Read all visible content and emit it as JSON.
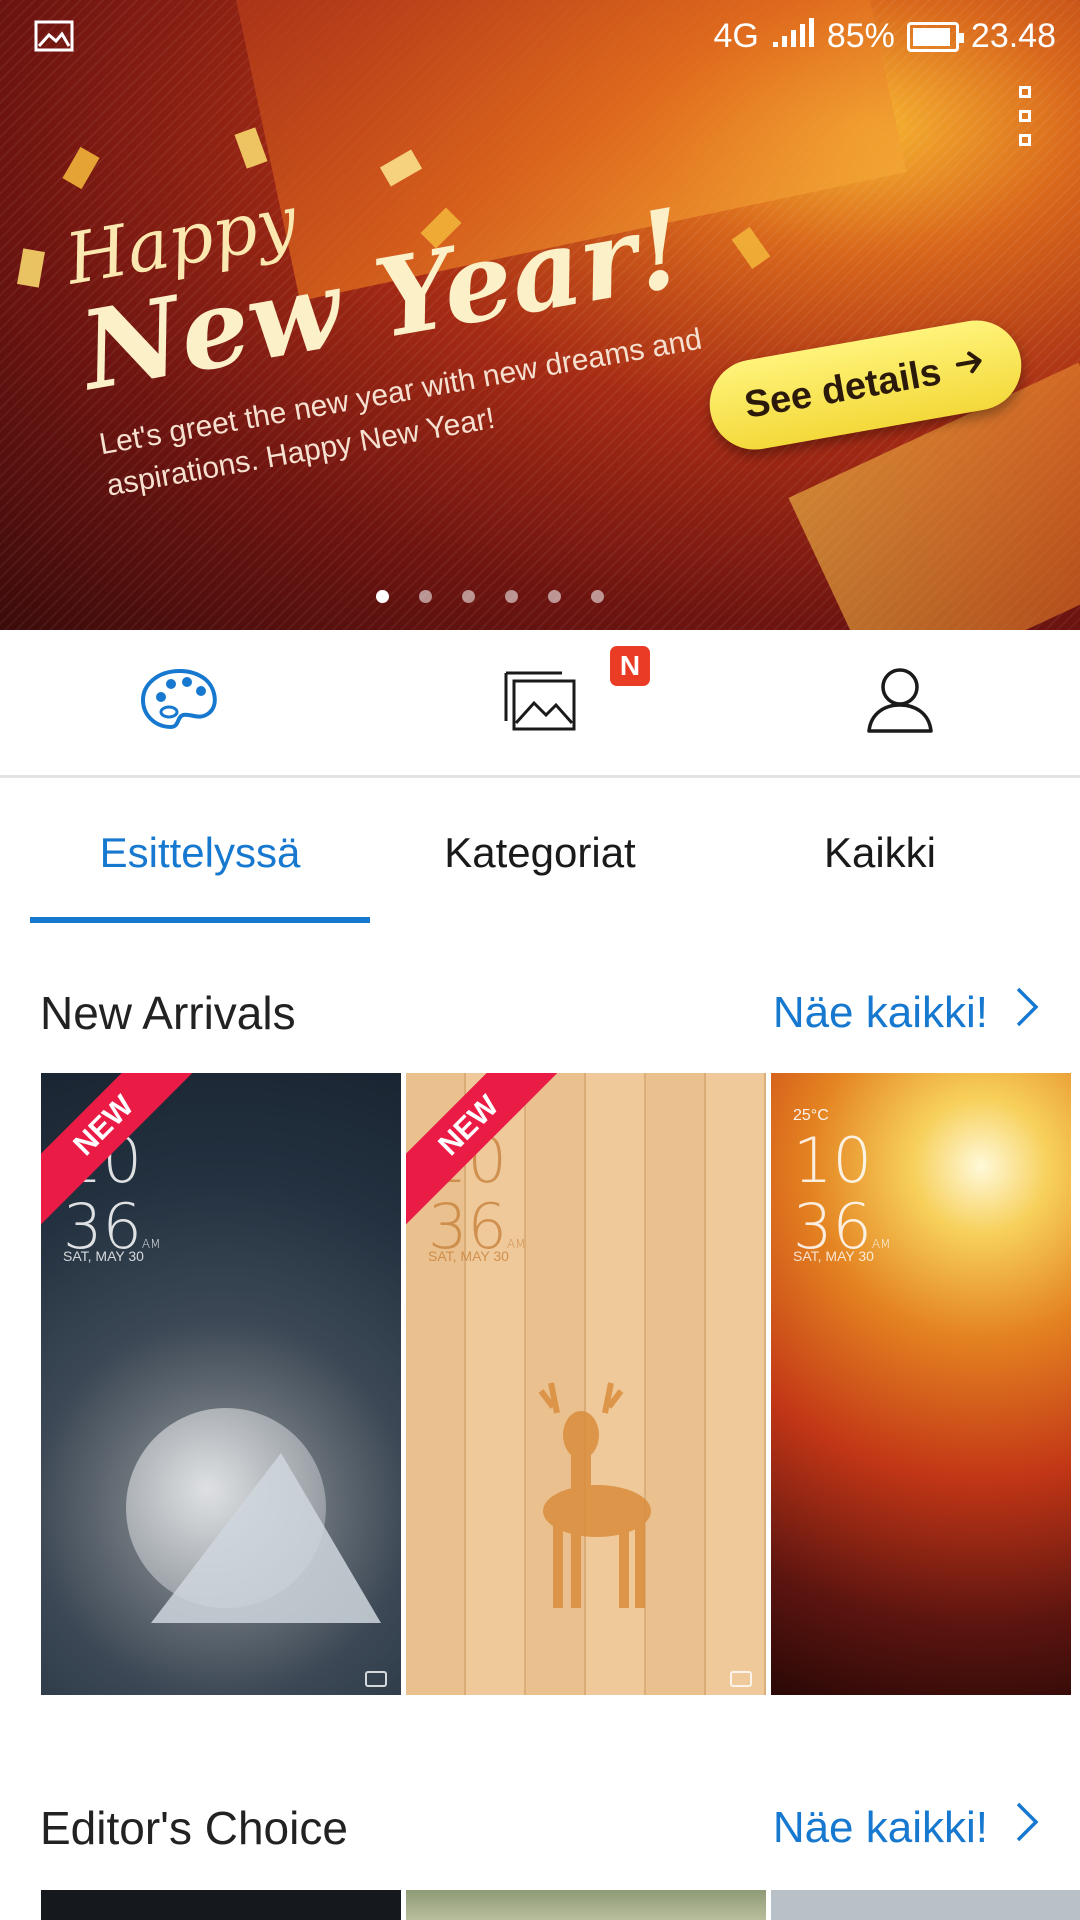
{
  "status_bar": {
    "network": "4G",
    "battery": "85%",
    "time": "23.48"
  },
  "banner": {
    "title_line1": "Happy",
    "title_line2": "New Year!",
    "description": "Let's greet the new year with new dreams and aspirations. Happy New Year!",
    "cta_label": "See details",
    "page_count": 6,
    "active_page": 0
  },
  "icon_tabs": [
    {
      "name": "themes",
      "icon": "palette-icon",
      "active": true
    },
    {
      "name": "wallpapers",
      "icon": "gallery-icon",
      "badge": "N"
    },
    {
      "name": "profile",
      "icon": "person-icon"
    }
  ],
  "tabs": [
    {
      "label": "Esittelyssä",
      "active": true
    },
    {
      "label": "Kategoriat"
    },
    {
      "label": "Kaikki"
    }
  ],
  "sections": {
    "new_arrivals": {
      "title": "New Arrivals",
      "see_all": "Näe kaikki!",
      "items": [
        {
          "badge": "NEW",
          "time_hour": "10",
          "time_min": "36",
          "ampm": "AM",
          "date": "SAT, MAY 30"
        },
        {
          "badge": "NEW",
          "time_hour": "10",
          "time_min": "36",
          "ampm": "AM",
          "date": "SAT, MAY 30"
        },
        {
          "temp": "25°C",
          "time_hour": "10",
          "time_min": "36",
          "ampm": "AM",
          "date": "SAT, MAY 30"
        }
      ]
    },
    "editors_choice": {
      "title": "Editor's Choice",
      "see_all": "Näe kaikki!"
    }
  },
  "colors": {
    "accent": "#1778cf",
    "badge_red": "#ea3b25",
    "ribbon_red": "#ea1c45"
  }
}
